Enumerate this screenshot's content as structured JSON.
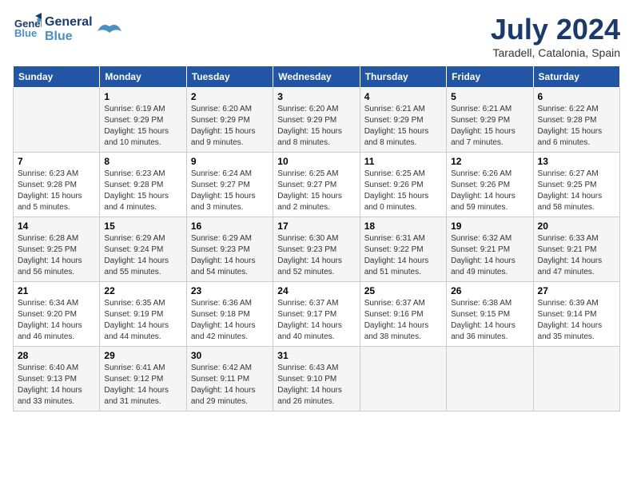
{
  "logo": {
    "line1": "General",
    "line2": "Blue"
  },
  "title": "July 2024",
  "subtitle": "Taradell, Catalonia, Spain",
  "days_of_week": [
    "Sunday",
    "Monday",
    "Tuesday",
    "Wednesday",
    "Thursday",
    "Friday",
    "Saturday"
  ],
  "weeks": [
    [
      {
        "day": "",
        "info": ""
      },
      {
        "day": "1",
        "info": "Sunrise: 6:19 AM\nSunset: 9:29 PM\nDaylight: 15 hours\nand 10 minutes."
      },
      {
        "day": "2",
        "info": "Sunrise: 6:20 AM\nSunset: 9:29 PM\nDaylight: 15 hours\nand 9 minutes."
      },
      {
        "day": "3",
        "info": "Sunrise: 6:20 AM\nSunset: 9:29 PM\nDaylight: 15 hours\nand 8 minutes."
      },
      {
        "day": "4",
        "info": "Sunrise: 6:21 AM\nSunset: 9:29 PM\nDaylight: 15 hours\nand 8 minutes."
      },
      {
        "day": "5",
        "info": "Sunrise: 6:21 AM\nSunset: 9:29 PM\nDaylight: 15 hours\nand 7 minutes."
      },
      {
        "day": "6",
        "info": "Sunrise: 6:22 AM\nSunset: 9:28 PM\nDaylight: 15 hours\nand 6 minutes."
      }
    ],
    [
      {
        "day": "7",
        "info": "Sunrise: 6:23 AM\nSunset: 9:28 PM\nDaylight: 15 hours\nand 5 minutes."
      },
      {
        "day": "8",
        "info": "Sunrise: 6:23 AM\nSunset: 9:28 PM\nDaylight: 15 hours\nand 4 minutes."
      },
      {
        "day": "9",
        "info": "Sunrise: 6:24 AM\nSunset: 9:27 PM\nDaylight: 15 hours\nand 3 minutes."
      },
      {
        "day": "10",
        "info": "Sunrise: 6:25 AM\nSunset: 9:27 PM\nDaylight: 15 hours\nand 2 minutes."
      },
      {
        "day": "11",
        "info": "Sunrise: 6:25 AM\nSunset: 9:26 PM\nDaylight: 15 hours\nand 0 minutes."
      },
      {
        "day": "12",
        "info": "Sunrise: 6:26 AM\nSunset: 9:26 PM\nDaylight: 14 hours\nand 59 minutes."
      },
      {
        "day": "13",
        "info": "Sunrise: 6:27 AM\nSunset: 9:25 PM\nDaylight: 14 hours\nand 58 minutes."
      }
    ],
    [
      {
        "day": "14",
        "info": "Sunrise: 6:28 AM\nSunset: 9:25 PM\nDaylight: 14 hours\nand 56 minutes."
      },
      {
        "day": "15",
        "info": "Sunrise: 6:29 AM\nSunset: 9:24 PM\nDaylight: 14 hours\nand 55 minutes."
      },
      {
        "day": "16",
        "info": "Sunrise: 6:29 AM\nSunset: 9:23 PM\nDaylight: 14 hours\nand 54 minutes."
      },
      {
        "day": "17",
        "info": "Sunrise: 6:30 AM\nSunset: 9:23 PM\nDaylight: 14 hours\nand 52 minutes."
      },
      {
        "day": "18",
        "info": "Sunrise: 6:31 AM\nSunset: 9:22 PM\nDaylight: 14 hours\nand 51 minutes."
      },
      {
        "day": "19",
        "info": "Sunrise: 6:32 AM\nSunset: 9:21 PM\nDaylight: 14 hours\nand 49 minutes."
      },
      {
        "day": "20",
        "info": "Sunrise: 6:33 AM\nSunset: 9:21 PM\nDaylight: 14 hours\nand 47 minutes."
      }
    ],
    [
      {
        "day": "21",
        "info": "Sunrise: 6:34 AM\nSunset: 9:20 PM\nDaylight: 14 hours\nand 46 minutes."
      },
      {
        "day": "22",
        "info": "Sunrise: 6:35 AM\nSunset: 9:19 PM\nDaylight: 14 hours\nand 44 minutes."
      },
      {
        "day": "23",
        "info": "Sunrise: 6:36 AM\nSunset: 9:18 PM\nDaylight: 14 hours\nand 42 minutes."
      },
      {
        "day": "24",
        "info": "Sunrise: 6:37 AM\nSunset: 9:17 PM\nDaylight: 14 hours\nand 40 minutes."
      },
      {
        "day": "25",
        "info": "Sunrise: 6:37 AM\nSunset: 9:16 PM\nDaylight: 14 hours\nand 38 minutes."
      },
      {
        "day": "26",
        "info": "Sunrise: 6:38 AM\nSunset: 9:15 PM\nDaylight: 14 hours\nand 36 minutes."
      },
      {
        "day": "27",
        "info": "Sunrise: 6:39 AM\nSunset: 9:14 PM\nDaylight: 14 hours\nand 35 minutes."
      }
    ],
    [
      {
        "day": "28",
        "info": "Sunrise: 6:40 AM\nSunset: 9:13 PM\nDaylight: 14 hours\nand 33 minutes."
      },
      {
        "day": "29",
        "info": "Sunrise: 6:41 AM\nSunset: 9:12 PM\nDaylight: 14 hours\nand 31 minutes."
      },
      {
        "day": "30",
        "info": "Sunrise: 6:42 AM\nSunset: 9:11 PM\nDaylight: 14 hours\nand 29 minutes."
      },
      {
        "day": "31",
        "info": "Sunrise: 6:43 AM\nSunset: 9:10 PM\nDaylight: 14 hours\nand 26 minutes."
      },
      {
        "day": "",
        "info": ""
      },
      {
        "day": "",
        "info": ""
      },
      {
        "day": "",
        "info": ""
      }
    ]
  ]
}
